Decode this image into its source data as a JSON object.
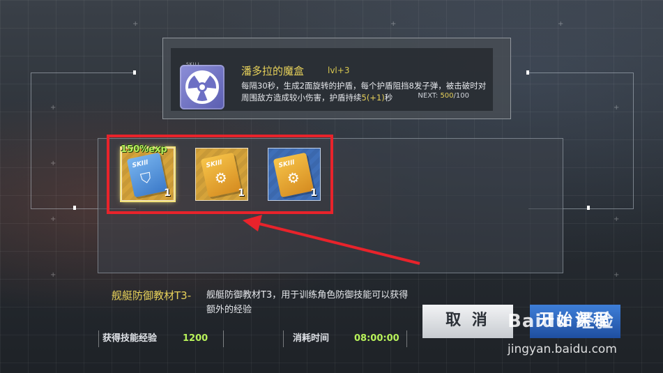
{
  "skill": {
    "tag": "SKILL",
    "name": "潘多拉的魔盒",
    "level": "lvl+3",
    "desc_prefix": "每隔30秒，生成2面旋转的护盾，每个护盾阻挡8发子弹，被击破时对周围敌方造成较小伤害，护盾持续",
    "desc_highlight": "5(+1)",
    "desc_suffix": "秒",
    "next_label": "NEXT:",
    "next_current": "500",
    "next_total": "/100",
    "icon": "radiation-icon"
  },
  "items": [
    {
      "badge": "150%exp",
      "book_label": "SKIll",
      "count": "1",
      "color": "gold",
      "book_color": "blue",
      "symbol": "shield-icon",
      "tier": "3"
    },
    {
      "badge": "",
      "book_label": "SKIll",
      "count": "1",
      "color": "gold",
      "book_color": "gold",
      "symbol": "gear-icon",
      "tier": "3"
    },
    {
      "badge": "",
      "book_label": "SKIll",
      "count": "1",
      "color": "blue",
      "book_color": "gold",
      "symbol": "gear-icon",
      "tier": "1"
    }
  ],
  "material": {
    "name": "舰艇防御教材T3-",
    "desc": "舰艇防御教材T3，用于训练角色防御技能可以获得额外的经验"
  },
  "stats": {
    "exp_label": "获得技能经验",
    "exp_value": "1200",
    "time_label": "消耗时间",
    "time_value": "08:00:00"
  },
  "buttons": {
    "cancel": "取 消",
    "start": "开始课程"
  },
  "watermark": {
    "brand": "Baidu 经验",
    "url": "jingyan.baidu.com"
  },
  "colors": {
    "highlight_frame": "#e8232b",
    "accent_yellow": "#e8d25a",
    "accent_green": "#b8f25a"
  }
}
